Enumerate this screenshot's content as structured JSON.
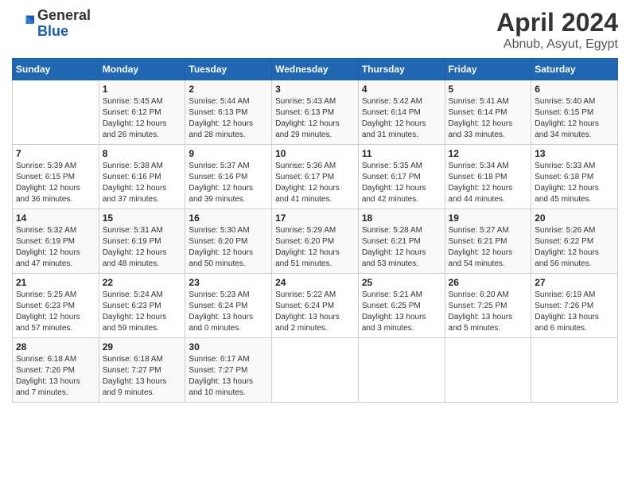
{
  "logo": {
    "line1": "General",
    "line2": "Blue"
  },
  "title": "April 2024",
  "subtitle": "Abnub, Asyut, Egypt",
  "days_header": [
    "Sunday",
    "Monday",
    "Tuesday",
    "Wednesday",
    "Thursday",
    "Friday",
    "Saturday"
  ],
  "weeks": [
    [
      {
        "num": "",
        "info": ""
      },
      {
        "num": "1",
        "info": "Sunrise: 5:45 AM\nSunset: 6:12 PM\nDaylight: 12 hours\nand 26 minutes."
      },
      {
        "num": "2",
        "info": "Sunrise: 5:44 AM\nSunset: 6:13 PM\nDaylight: 12 hours\nand 28 minutes."
      },
      {
        "num": "3",
        "info": "Sunrise: 5:43 AM\nSunset: 6:13 PM\nDaylight: 12 hours\nand 29 minutes."
      },
      {
        "num": "4",
        "info": "Sunrise: 5:42 AM\nSunset: 6:14 PM\nDaylight: 12 hours\nand 31 minutes."
      },
      {
        "num": "5",
        "info": "Sunrise: 5:41 AM\nSunset: 6:14 PM\nDaylight: 12 hours\nand 33 minutes."
      },
      {
        "num": "6",
        "info": "Sunrise: 5:40 AM\nSunset: 6:15 PM\nDaylight: 12 hours\nand 34 minutes."
      }
    ],
    [
      {
        "num": "7",
        "info": "Sunrise: 5:39 AM\nSunset: 6:15 PM\nDaylight: 12 hours\nand 36 minutes."
      },
      {
        "num": "8",
        "info": "Sunrise: 5:38 AM\nSunset: 6:16 PM\nDaylight: 12 hours\nand 37 minutes."
      },
      {
        "num": "9",
        "info": "Sunrise: 5:37 AM\nSunset: 6:16 PM\nDaylight: 12 hours\nand 39 minutes."
      },
      {
        "num": "10",
        "info": "Sunrise: 5:36 AM\nSunset: 6:17 PM\nDaylight: 12 hours\nand 41 minutes."
      },
      {
        "num": "11",
        "info": "Sunrise: 5:35 AM\nSunset: 6:17 PM\nDaylight: 12 hours\nand 42 minutes."
      },
      {
        "num": "12",
        "info": "Sunrise: 5:34 AM\nSunset: 6:18 PM\nDaylight: 12 hours\nand 44 minutes."
      },
      {
        "num": "13",
        "info": "Sunrise: 5:33 AM\nSunset: 6:18 PM\nDaylight: 12 hours\nand 45 minutes."
      }
    ],
    [
      {
        "num": "14",
        "info": "Sunrise: 5:32 AM\nSunset: 6:19 PM\nDaylight: 12 hours\nand 47 minutes."
      },
      {
        "num": "15",
        "info": "Sunrise: 5:31 AM\nSunset: 6:19 PM\nDaylight: 12 hours\nand 48 minutes."
      },
      {
        "num": "16",
        "info": "Sunrise: 5:30 AM\nSunset: 6:20 PM\nDaylight: 12 hours\nand 50 minutes."
      },
      {
        "num": "17",
        "info": "Sunrise: 5:29 AM\nSunset: 6:20 PM\nDaylight: 12 hours\nand 51 minutes."
      },
      {
        "num": "18",
        "info": "Sunrise: 5:28 AM\nSunset: 6:21 PM\nDaylight: 12 hours\nand 53 minutes."
      },
      {
        "num": "19",
        "info": "Sunrise: 5:27 AM\nSunset: 6:21 PM\nDaylight: 12 hours\nand 54 minutes."
      },
      {
        "num": "20",
        "info": "Sunrise: 5:26 AM\nSunset: 6:22 PM\nDaylight: 12 hours\nand 56 minutes."
      }
    ],
    [
      {
        "num": "21",
        "info": "Sunrise: 5:25 AM\nSunset: 6:23 PM\nDaylight: 12 hours\nand 57 minutes."
      },
      {
        "num": "22",
        "info": "Sunrise: 5:24 AM\nSunset: 6:23 PM\nDaylight: 12 hours\nand 59 minutes."
      },
      {
        "num": "23",
        "info": "Sunrise: 5:23 AM\nSunset: 6:24 PM\nDaylight: 13 hours\nand 0 minutes."
      },
      {
        "num": "24",
        "info": "Sunrise: 5:22 AM\nSunset: 6:24 PM\nDaylight: 13 hours\nand 2 minutes."
      },
      {
        "num": "25",
        "info": "Sunrise: 5:21 AM\nSunset: 6:25 PM\nDaylight: 13 hours\nand 3 minutes."
      },
      {
        "num": "26",
        "info": "Sunrise: 6:20 AM\nSunset: 7:25 PM\nDaylight: 13 hours\nand 5 minutes."
      },
      {
        "num": "27",
        "info": "Sunrise: 6:19 AM\nSunset: 7:26 PM\nDaylight: 13 hours\nand 6 minutes."
      }
    ],
    [
      {
        "num": "28",
        "info": "Sunrise: 6:18 AM\nSunset: 7:26 PM\nDaylight: 13 hours\nand 7 minutes."
      },
      {
        "num": "29",
        "info": "Sunrise: 6:18 AM\nSunset: 7:27 PM\nDaylight: 13 hours\nand 9 minutes."
      },
      {
        "num": "30",
        "info": "Sunrise: 6:17 AM\nSunset: 7:27 PM\nDaylight: 13 hours\nand 10 minutes."
      },
      {
        "num": "",
        "info": ""
      },
      {
        "num": "",
        "info": ""
      },
      {
        "num": "",
        "info": ""
      },
      {
        "num": "",
        "info": ""
      }
    ]
  ]
}
